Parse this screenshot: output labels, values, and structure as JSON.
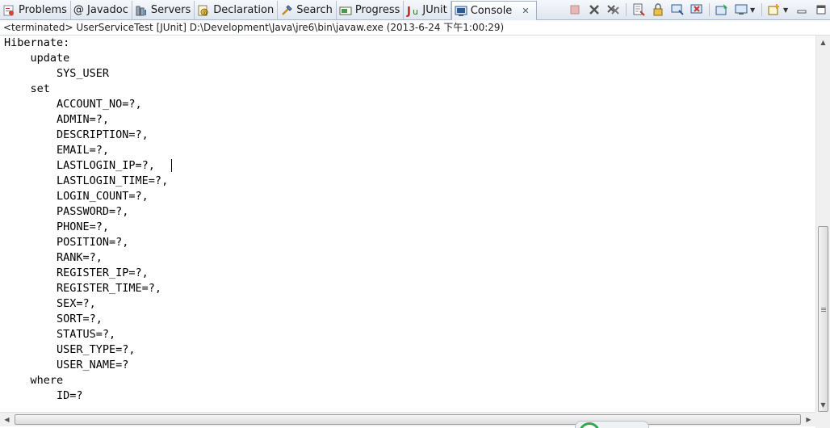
{
  "tabs": [
    {
      "label": "Problems",
      "icon": "problems-icon",
      "active": false
    },
    {
      "label": "@ Javadoc",
      "icon": "",
      "active": false
    },
    {
      "label": "Servers",
      "icon": "servers-icon",
      "active": false
    },
    {
      "label": "Declaration",
      "icon": "declaration-icon",
      "active": false
    },
    {
      "label": "Search",
      "icon": "search-icon",
      "active": false
    },
    {
      "label": "Progress",
      "icon": "progress-icon",
      "active": false
    },
    {
      "label": "JUnit",
      "icon": "junit-icon",
      "active": false
    },
    {
      "label": "Console",
      "icon": "console-icon",
      "active": true,
      "close": "✕"
    }
  ],
  "status_line": "<terminated> UserServiceTest [JUnit] D:\\Development\\Java\\jre6\\bin\\javaw.exe (2013-6-24 下午1:00:29)",
  "console_lines": [
    "Hibernate: ",
    "    update",
    "        SYS_USER ",
    "    set",
    "        ACCOUNT_NO=?,",
    "        ADMIN=?,",
    "        DESCRIPTION=?,",
    "        EMAIL=?,",
    "        LASTLOGIN_IP=?,",
    "        LASTLOGIN_TIME=?,",
    "        LOGIN_COUNT=?,",
    "        PASSWORD=?,",
    "        PHONE=?,",
    "        POSITION=?,",
    "        RANK=?,",
    "        REGISTER_IP=?,",
    "        REGISTER_TIME=?,",
    "        SEX=?,",
    "        SORT=?,",
    "        STATUS=?,",
    "        USER_TYPE=?,",
    "        USER_NAME=? ",
    "    where",
    "        ID=?"
  ],
  "colors": {
    "tab_bar_bg": "#dfe6ef",
    "text": "#000000",
    "terminate_disabled": "#d88b8b"
  }
}
